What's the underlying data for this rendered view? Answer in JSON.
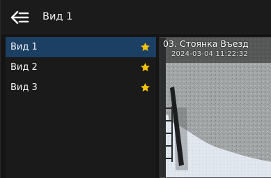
{
  "header": {
    "back_icon": "back-arrow-menu-icon",
    "title": "Вид 1"
  },
  "sidebar": {
    "items": [
      {
        "label": "Вид 1",
        "selected": true,
        "icon": "star-icon"
      },
      {
        "label": "Вид 2",
        "selected": false,
        "icon": "star-icon"
      },
      {
        "label": "Вид 3",
        "selected": false,
        "icon": "star-icon"
      }
    ]
  },
  "camera": {
    "title": "03. Стоянка Въезд",
    "timestamp": "2024-03-04 11:22:32"
  },
  "colors": {
    "selected": "#1c3f64",
    "star": "#f4c20d",
    "header": "#1b1b1b"
  }
}
